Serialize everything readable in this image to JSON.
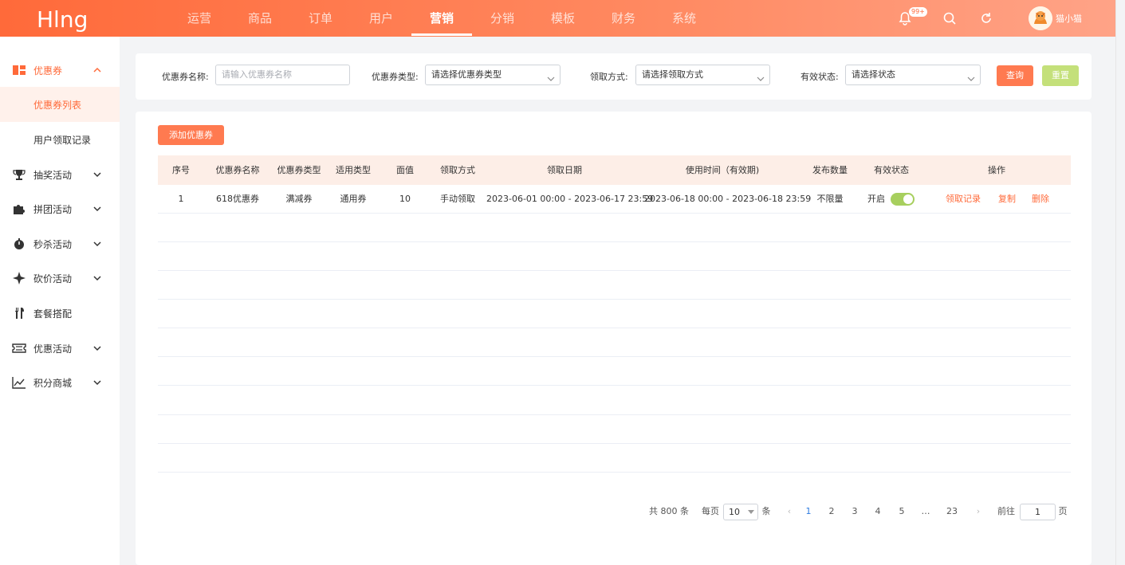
{
  "app": {
    "logo": "Hlng",
    "username": "猫小猫",
    "notification_badge": "99+"
  },
  "nav": {
    "items": [
      "运营",
      "商品",
      "订单",
      "用户",
      "营销",
      "分销",
      "模板",
      "财务",
      "系统"
    ],
    "active_index": 4
  },
  "sidebar": {
    "items": [
      {
        "label": "优惠券",
        "icon": "ticket-icon",
        "expanded": true
      },
      {
        "label": "优惠券列表",
        "sub": true,
        "current": true
      },
      {
        "label": "用户领取记录",
        "sub": true
      },
      {
        "label": "抽奖活动",
        "icon": "trophy-icon"
      },
      {
        "label": "拼团活动",
        "icon": "puzzle-icon"
      },
      {
        "label": "秒杀活动",
        "icon": "stopwatch-icon"
      },
      {
        "label": "砍价活动",
        "icon": "sparkle-icon"
      },
      {
        "label": "套餐搭配",
        "icon": "utensils-icon"
      },
      {
        "label": "优惠活动",
        "icon": "coupon-stub-icon"
      },
      {
        "label": "积分商城",
        "icon": "chart-icon"
      }
    ]
  },
  "filters": {
    "name_label": "优惠券名称:",
    "name_placeholder": "请输入优惠券名称",
    "type_label": "优惠券类型:",
    "type_value": "请选择优惠券类型",
    "method_label": "领取方式:",
    "method_value": "请选择领取方式",
    "status_label": "有效状态:",
    "status_value": "请选择状态",
    "query_button": "查询",
    "reset_button": "重置"
  },
  "actions": {
    "add_button": "添加优惠券"
  },
  "table": {
    "headers": [
      "序号",
      "优惠券名称",
      "优惠券类型",
      "适用类型",
      "面值",
      "领取方式",
      "领取日期",
      "使用时间（有效期)",
      "发布数量",
      "有效状态",
      "操作"
    ],
    "rows": [
      {
        "index": "1",
        "name": "618优惠券",
        "type": "满减券",
        "scope": "通用券",
        "value": "10",
        "method": "手动领取",
        "claim_date": "2023-06-01 00:00 - 2023-06-17 23:59",
        "use_time": "2023-06-18 00:00 - 2023-06-18 23:59",
        "quantity": "不限量",
        "status": "开启",
        "status_on": true,
        "op_records": "领取记录",
        "op_copy": "复制",
        "op_delete": "删除"
      }
    ]
  },
  "pagination": {
    "total": "共 800 条",
    "per_page_label": "每页",
    "per_page_value": "10",
    "per_page_unit": "条",
    "prev": "‹",
    "pages": [
      "1",
      "2",
      "3",
      "4",
      "5",
      "…",
      "23"
    ],
    "current_page": "1",
    "next": "›",
    "goto_label": "前往",
    "goto_value": "1",
    "goto_unit": "页"
  },
  "colors": {
    "brand": "#ff6a3a",
    "accent_green": "#a7cf5e",
    "link": "#2d7be0"
  }
}
